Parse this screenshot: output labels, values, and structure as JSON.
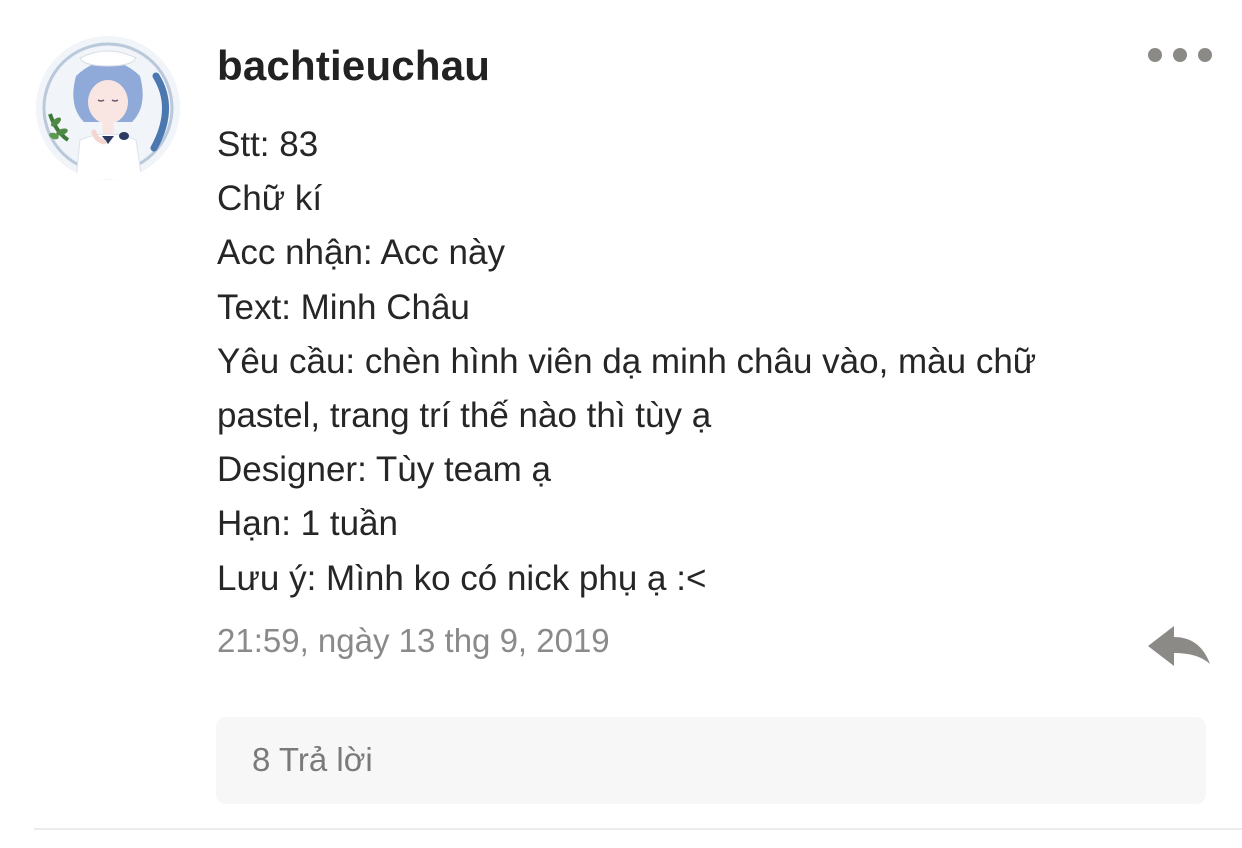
{
  "comment": {
    "username": "bachtieuchau",
    "body_lines": [
      "Stt: 83",
      "Chữ kí",
      "Acc nhận: Acc này",
      "Text: Minh Châu",
      "Yêu cầu: chèn hình viên dạ minh châu vào, màu chữ",
      "pastel, trang trí thế nào thì tùy ạ",
      "Designer: Tùy team ạ",
      "Hạn: 1 tuần",
      "Lưu ý: Mình ko có nick phụ ạ :<"
    ],
    "timestamp": "21:59, ngày 13 thg 9, 2019",
    "replies_label": "8 Trả lời"
  },
  "icons": {
    "more": "more-horizontal-icon",
    "reply": "reply-arrow-icon",
    "avatar": "user-avatar"
  },
  "colors": {
    "username": "#222222",
    "body_text": "#262626",
    "timestamp": "#8a8a8a",
    "icon": "#8c8a87",
    "replies_background": "#f7f7f7"
  }
}
